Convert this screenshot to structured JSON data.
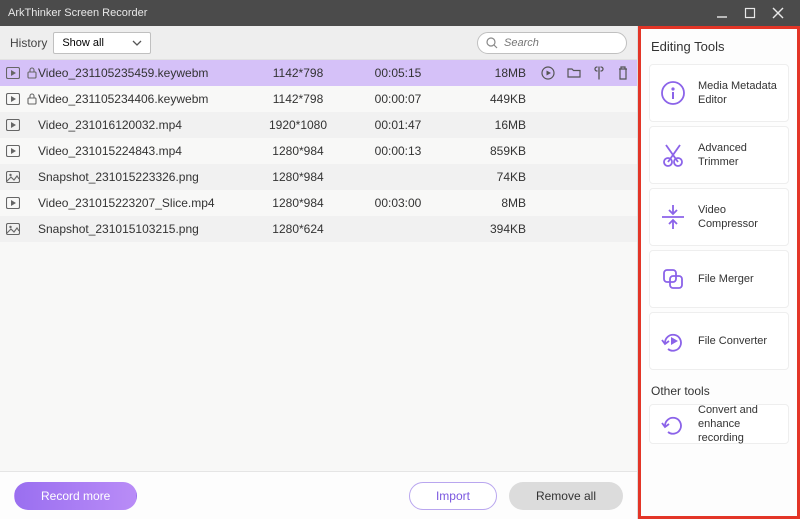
{
  "titlebar": {
    "title": "ArkThinker Screen Recorder"
  },
  "filter": {
    "history_label": "History",
    "show_value": "Show all",
    "search_placeholder": "Search"
  },
  "columns": {
    "name": "",
    "dimensions": "",
    "duration": "",
    "size": ""
  },
  "rows": [
    {
      "type": "video",
      "locked": true,
      "name": "Video_231105235459.keywebm",
      "dim": "1142*798",
      "dur": "00:05:15",
      "size": "18MB",
      "selected": true
    },
    {
      "type": "video",
      "locked": true,
      "name": "Video_231105234406.keywebm",
      "dim": "1142*798",
      "dur": "00:00:07",
      "size": "449KB",
      "selected": false
    },
    {
      "type": "video",
      "locked": false,
      "name": "Video_231016120032.mp4",
      "dim": "1920*1080",
      "dur": "00:01:47",
      "size": "16MB",
      "selected": false
    },
    {
      "type": "video",
      "locked": false,
      "name": "Video_231015224843.mp4",
      "dim": "1280*984",
      "dur": "00:00:13",
      "size": "859KB",
      "selected": false
    },
    {
      "type": "image",
      "locked": false,
      "name": "Snapshot_231015223326.png",
      "dim": "1280*984",
      "dur": "",
      "size": "74KB",
      "selected": false
    },
    {
      "type": "video",
      "locked": false,
      "name": "Video_231015223207_Slice.mp4",
      "dim": "1280*984",
      "dur": "00:03:00",
      "size": "8MB",
      "selected": false
    },
    {
      "type": "image",
      "locked": false,
      "name": "Snapshot_231015103215.png",
      "dim": "1280*624",
      "dur": "",
      "size": "394KB",
      "selected": false
    }
  ],
  "buttons": {
    "record_more": "Record more",
    "import": "Import",
    "remove_all": "Remove all"
  },
  "sidebar": {
    "editing_title": "Editing Tools",
    "tools": [
      {
        "id": "media-metadata-editor",
        "label": "Media Metadata Editor"
      },
      {
        "id": "advanced-trimmer",
        "label": "Advanced Trimmer"
      },
      {
        "id": "video-compressor",
        "label": "Video Compressor"
      },
      {
        "id": "file-merger",
        "label": "File Merger"
      },
      {
        "id": "file-converter",
        "label": "File Converter"
      }
    ],
    "other_title": "Other tools",
    "other_tools": [
      {
        "id": "convert-enhance-recording",
        "label": "Convert and enhance recording"
      }
    ]
  }
}
